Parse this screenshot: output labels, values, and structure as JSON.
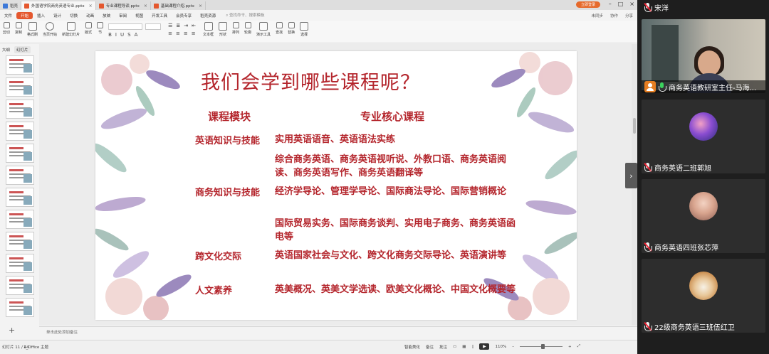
{
  "wps": {
    "tabs": [
      {
        "label": "稻壳",
        "icon_color": "#3c78d8"
      },
      {
        "label": "外国语学院商务英语专业.pptx",
        "icon_color": "#e4572e"
      },
      {
        "label": "专业课程导读.pptx",
        "icon_color": "#e4572e"
      },
      {
        "label": "基础课程介绍.pptx",
        "icon_color": "#e4572e"
      }
    ],
    "signin": "立即登录",
    "menu": [
      "文件",
      "开始",
      "插入",
      "设计",
      "切换",
      "动画",
      "放映",
      "审阅",
      "视图",
      "开发工具",
      "会员专享",
      "稻壳资源"
    ],
    "active_menu_index": 1,
    "search_placeholder": "查找命令、搜索模板",
    "menu_right": [
      "未同步",
      "协作",
      "分享"
    ],
    "ribbon": {
      "left": [
        "剪切",
        "复制",
        "格式刷",
        "当页开始",
        "新建幻灯片",
        "版式",
        "节"
      ],
      "right": [
        "文本框",
        "形状",
        "排列",
        "轮廓",
        "演示工具",
        "查找",
        "替换",
        "选择"
      ]
    },
    "panel_tabs": [
      "大纲",
      "幻灯片"
    ],
    "notes_placeholder": "单击此处添加备注",
    "status": {
      "slide_counter": "幻灯片 11 / 44",
      "theme": "1_Office 主题",
      "smart_beautify": "智能美化",
      "notes": "备注",
      "comments": "批注",
      "zoom": "110%"
    },
    "active_slide": 11,
    "slide": {
      "title": "我们会学到哪些课程呢？",
      "col_module": "课程模块",
      "col_course": "专业核心课程",
      "rows": [
        {
          "module": "英语知识与技能",
          "course": "实用英语语音、英语语法实练"
        },
        {
          "module": "",
          "course": "综合商务英语、商务英语视听说、外教口语、商务英语阅读、商务英语写作、商务英语翻译等"
        },
        {
          "module": "商务知识与技能",
          "course": "经济学导论、管理学导论、国际商法导论、国际营销概论"
        },
        {
          "module": "",
          "course": "国际贸易实务、国际商务谈判、实用电子商务、商务英语函电等"
        },
        {
          "module": "跨文化交际",
          "course": "英语国家社会与文化、跨文化商务交际导论、英语演讲等"
        },
        {
          "module": "人文素养",
          "course": "英美概况、英美文学选读、欧美文化概论、中国文化概要等"
        }
      ]
    }
  },
  "meeting": {
    "participants": [
      {
        "name": "宋洋",
        "mic": "muted"
      },
      {
        "name": "商务英语教研室主任-马海...",
        "mic": "on"
      },
      {
        "name": "商务英语二班郭旭",
        "mic": "muted"
      },
      {
        "name": "商务英语四班张芯萍",
        "mic": "muted"
      },
      {
        "name": "22级商务英语三班伍红卫",
        "mic": "muted"
      }
    ]
  },
  "colors": {
    "accent": "#e4572e",
    "slide_text": "#b4252c"
  }
}
